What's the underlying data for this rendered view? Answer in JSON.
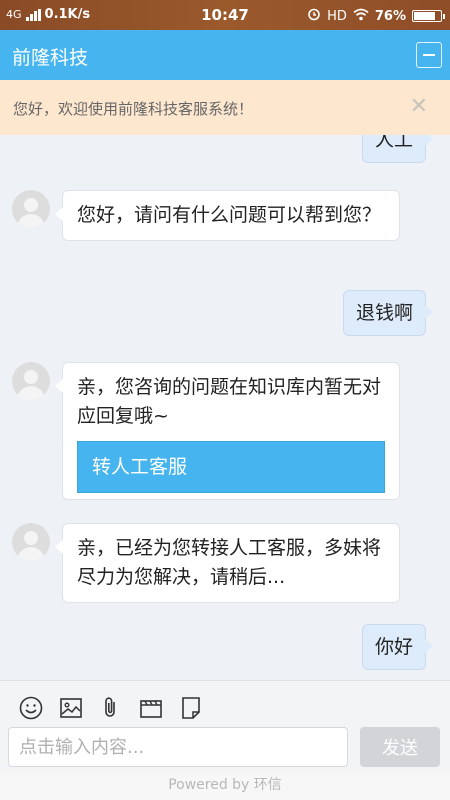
{
  "status_bar": {
    "network": "4G",
    "speed": "0.1K/s",
    "time": "10:47",
    "hd": "HD",
    "battery": "76%"
  },
  "header": {
    "title": "前隆科技",
    "minimize_icon": "minimize-icon",
    "color": "#46b5ef"
  },
  "notice": {
    "text": "您好，欢迎使用前隆科技客服系统！",
    "close_icon": "close-icon"
  },
  "messages": [
    {
      "from": "user",
      "text": "人工"
    },
    {
      "from": "agent",
      "text": "您好，请问有什么问题可以帮到您？"
    },
    {
      "from": "user",
      "text": "退钱啊"
    },
    {
      "from": "agent",
      "text": "亲，您咨询的问题在知识库内暂无对应回复哦~",
      "button": "转人工客服"
    },
    {
      "from": "agent",
      "text": "亲，已经为您转接人工客服，多妹将尽力为您解决，请稍后..."
    },
    {
      "from": "user",
      "text": "你好"
    }
  ],
  "toolbar": {
    "icons": [
      "emoji-icon",
      "image-icon",
      "attachment-icon",
      "video-icon",
      "document-icon"
    ],
    "input_placeholder": "点击输入内容...",
    "send_label": "发送"
  },
  "footer": {
    "powered_by": "Powered by 环信"
  }
}
